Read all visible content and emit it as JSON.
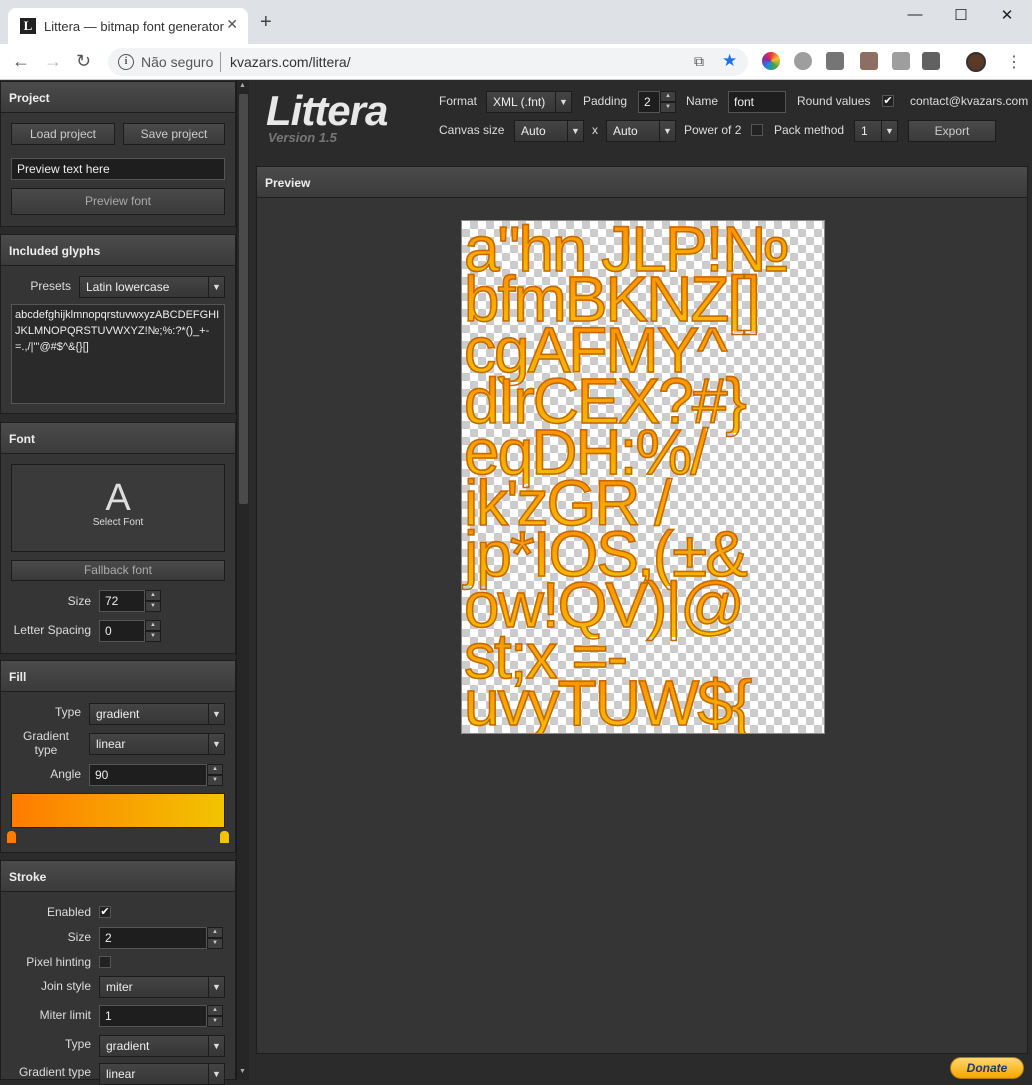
{
  "browser": {
    "tab_title": "Littera — bitmap font generator",
    "tab_favicon": "L",
    "tab_close": "✕",
    "new_tab": "+",
    "window_controls": {
      "minimize": "—",
      "maximize": "☐",
      "close": "✕"
    },
    "security_label": "Não seguro",
    "url": "kvazars.com/littera/"
  },
  "logo": {
    "title": "Littera",
    "version": "Version 1.5"
  },
  "topbar": {
    "format_label": "Format",
    "format_value": "XML (.fnt)",
    "padding_label": "Padding",
    "padding_value": "2",
    "name_label": "Name",
    "name_value": "font",
    "round_values_label": "Round values",
    "round_values_checked": true,
    "contact": "contact@kvazars.com",
    "canvas_size_label": "Canvas size",
    "canvas_w": "Auto",
    "canvas_x": "x",
    "canvas_h": "Auto",
    "power_of_2_label": "Power of 2",
    "pack_method_label": "Pack method",
    "pack_method_value": "1",
    "export_label": "Export"
  },
  "project": {
    "title": "Project",
    "load_label": "Load project",
    "save_label": "Save project",
    "preview_text": "Preview text here",
    "preview_font_label": "Preview font"
  },
  "glyphs": {
    "title": "Included glyphs",
    "presets_label": "Presets",
    "presets_value": "Latin lowercase",
    "glyph_text": "abcdefghijklmnopqrstuvwxyzABCDEFGHIJKLMNOPQRSTUVWXYZ!№;%:?*()_+-=.,/|\"'@#$^&{}[]"
  },
  "font": {
    "title": "Font",
    "select_letter": "A",
    "select_label": "Select Font",
    "fallback_label": "Fallback font",
    "size_label": "Size",
    "size_value": "72",
    "spacing_label": "Letter Spacing",
    "spacing_value": "0"
  },
  "fill": {
    "title": "Fill",
    "type_label": "Type",
    "type_value": "gradient",
    "gradient_type_label": "Gradient type",
    "gradient_type_value": "linear",
    "angle_label": "Angle",
    "angle_value": "90",
    "gradient_start": "#ff7c00",
    "gradient_end": "#f2c400"
  },
  "stroke": {
    "title": "Stroke",
    "enabled_label": "Enabled",
    "enabled_checked": true,
    "size_label": "Size",
    "size_value": "2",
    "pixel_hinting_label": "Pixel hinting",
    "join_style_label": "Join style",
    "join_style_value": "miter",
    "miter_limit_label": "Miter limit",
    "miter_limit_value": "1",
    "type_label": "Type",
    "type_value": "gradient",
    "gradient_type_label": "Gradient type",
    "gradient_type_value": "linear"
  },
  "preview": {
    "title": "Preview",
    "atlas_rows": [
      "a\"hn  JLP!№",
      "bfmBKNZ[]",
      "cgAFMY^",
      "dIrCEX?#}",
      "eqDH:%/",
      "ik'zGR /",
      "jp*IOS,(±&",
      "ow!QV)|@",
      "st;x  =-",
      "uvyTUW${"
    ]
  },
  "donate_label": "Donate",
  "icons": {
    "chevron": "▼",
    "up": "▲",
    "down": "▼",
    "check": "✔"
  }
}
